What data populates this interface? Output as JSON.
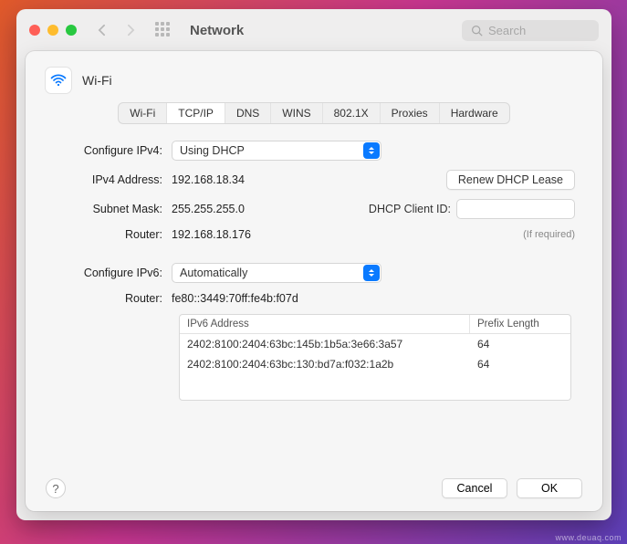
{
  "toolbar": {
    "title": "Network",
    "search_placeholder": "Search"
  },
  "sheet": {
    "title": "Wi-Fi",
    "tabs": [
      "Wi-Fi",
      "TCP/IP",
      "DNS",
      "WINS",
      "802.1X",
      "Proxies",
      "Hardware"
    ],
    "active_tab": 1
  },
  "ipv4": {
    "configure_label": "Configure IPv4:",
    "configure_value": "Using DHCP",
    "address_label": "IPv4 Address:",
    "address_value": "192.168.18.34",
    "subnet_label": "Subnet Mask:",
    "subnet_value": "255.255.255.0",
    "router_label": "Router:",
    "router_value": "192.168.18.176",
    "renew_button": "Renew DHCP Lease",
    "client_id_label": "DHCP Client ID:",
    "client_id_value": "",
    "client_id_hint": "(If required)"
  },
  "ipv6": {
    "configure_label": "Configure IPv6:",
    "configure_value": "Automatically",
    "router_label": "Router:",
    "router_value": "fe80::3449:70ff:fe4b:f07d",
    "table_headers": {
      "address": "IPv6 Address",
      "prefix": "Prefix Length"
    },
    "rows": [
      {
        "address": "2402:8100:2404:63bc:145b:1b5a:3e66:3a57",
        "prefix": "64"
      },
      {
        "address": "2402:8100:2404:63bc:130:bd7a:f032:1a2b",
        "prefix": "64"
      }
    ]
  },
  "footer": {
    "help": "?",
    "cancel": "Cancel",
    "ok": "OK"
  },
  "watermark": "www.deuaq.com"
}
